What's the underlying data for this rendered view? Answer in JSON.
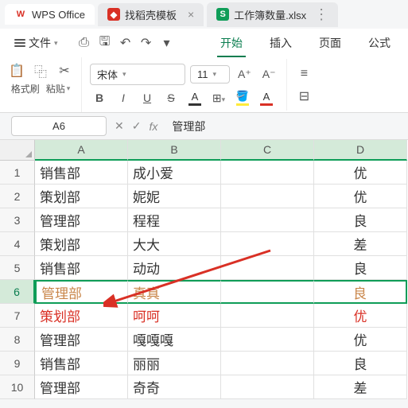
{
  "tabs": {
    "wps": "WPS Office",
    "template": "找稻壳模板",
    "file": "工作簿数量.xlsx"
  },
  "menu": {
    "file": "文件",
    "start": "开始",
    "insert": "插入",
    "page": "页面",
    "formula": "公式"
  },
  "toolbar": {
    "brush": "格式刷",
    "paste": "粘贴",
    "font": "宋体",
    "size": "11",
    "bold": "B",
    "italic": "I",
    "underline": "U",
    "strike": "S",
    "aplus": "A⁺",
    "aminus": "A⁻"
  },
  "cellref": "A6",
  "formula": "管理部",
  "columns": [
    "A",
    "B",
    "C",
    "D"
  ],
  "rows": [
    "1",
    "2",
    "3",
    "4",
    "5",
    "6",
    "7",
    "8",
    "9",
    "10"
  ],
  "data": [
    [
      "销售部",
      "成小爱",
      "",
      "优"
    ],
    [
      "策划部",
      "妮妮",
      "",
      "优"
    ],
    [
      "管理部",
      "程程",
      "",
      "良"
    ],
    [
      "策划部",
      "大大",
      "",
      "差"
    ],
    [
      "销售部",
      "动动",
      "",
      "良"
    ],
    [
      "管理部",
      "真真",
      "",
      "良"
    ],
    [
      "策划部",
      "呵呵",
      "",
      "优"
    ],
    [
      "管理部",
      "嘎嘎嘎",
      "",
      "优"
    ],
    [
      "销售部",
      "丽丽",
      "",
      "良"
    ],
    [
      "管理部",
      "奇奇",
      "",
      "差"
    ]
  ]
}
